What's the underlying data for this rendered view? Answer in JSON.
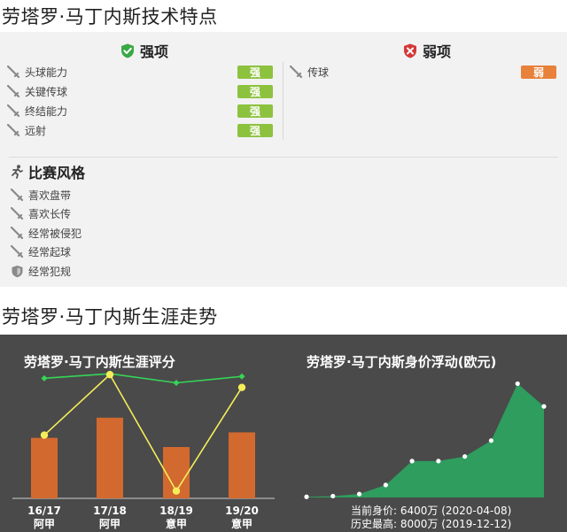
{
  "section1_title": "劳塔罗·马丁内斯技术特点",
  "strong": {
    "title": "强项",
    "items": [
      {
        "label": "头球能力",
        "badge": "强"
      },
      {
        "label": "关键传球",
        "badge": "强"
      },
      {
        "label": "终结能力",
        "badge": "强"
      },
      {
        "label": "远射",
        "badge": "强"
      }
    ]
  },
  "weak": {
    "title": "弱项",
    "items": [
      {
        "label": "传球",
        "badge": "弱"
      }
    ]
  },
  "style": {
    "title": "比赛风格",
    "items": [
      {
        "label": "喜欢盘带",
        "icon": "sword-icon"
      },
      {
        "label": "喜欢长传",
        "icon": "sword-icon"
      },
      {
        "label": "经常被侵犯",
        "icon": "sword-icon"
      },
      {
        "label": "经常起球",
        "icon": "sword-icon"
      },
      {
        "label": "经常犯规",
        "icon": "shield-icon"
      }
    ]
  },
  "section2_title": "劳塔罗·马丁内斯生涯走势",
  "colors": {
    "strong_badge": "#8dc23f",
    "weak_badge": "#e8813a",
    "bar": "#d2692f",
    "yellow_line": "#f5ee5a",
    "green_line": "#34d657",
    "area": "#2e9d5e",
    "dark_bg": "#4a4a4a"
  },
  "chart_data": [
    {
      "type": "bar",
      "title": "劳塔罗·马丁内斯生涯评分",
      "categories": [
        "16/17",
        "17/18",
        "18/19",
        "19/20"
      ],
      "leagues": [
        "阿甲",
        "阿甲",
        "意甲",
        "意甲"
      ],
      "bar_values": [
        6.6,
        8.8,
        5.6,
        7.2
      ],
      "yellow_values": [
        6.9,
        13.5,
        0.8,
        12.1
      ],
      "green_values": [
        13.1,
        13.6,
        12.6,
        13.3
      ],
      "ylim": [
        0,
        14
      ]
    },
    {
      "type": "area",
      "title": "劳塔罗·马丁内斯身价浮动(欧元)",
      "values": [
        30,
        60,
        150,
        550,
        1600,
        1600,
        1800,
        2500,
        5000,
        4000
      ],
      "ylim": [
        0,
        5600
      ],
      "current_value": "当前身价: 6400万 (2020-04-08)",
      "historical_high": "历史最高: 8000万 (2019-12-12)"
    }
  ]
}
